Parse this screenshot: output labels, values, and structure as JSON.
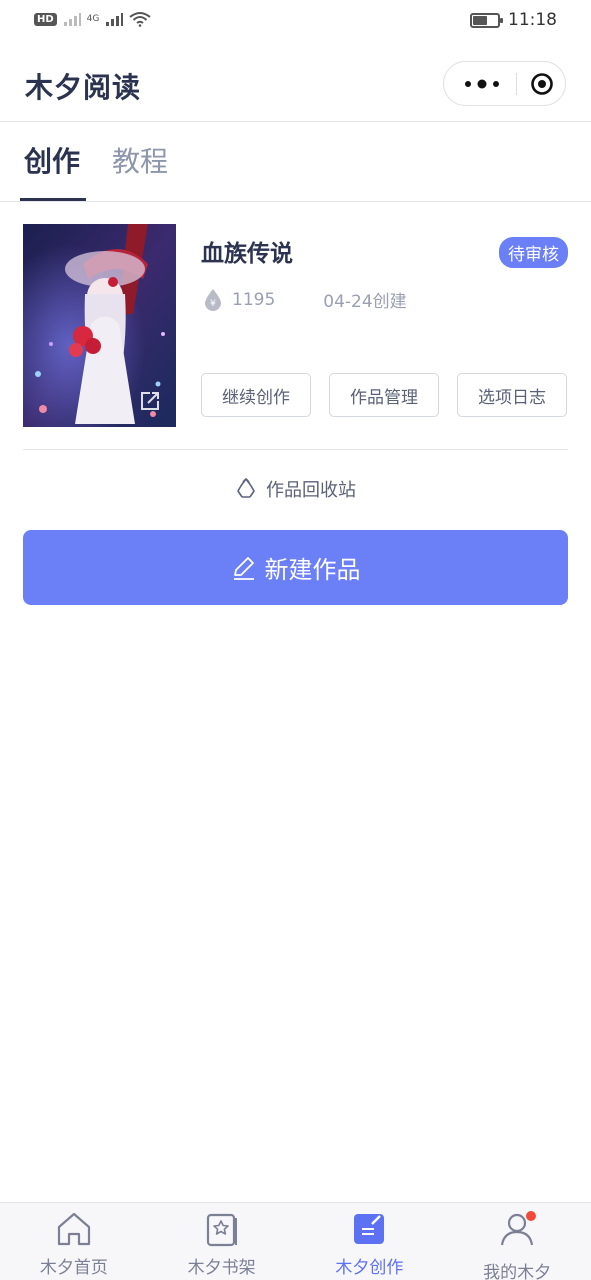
{
  "status_bar": {
    "network_badge": "HD",
    "network_gen": "4G",
    "time": "11:18",
    "battery_level": 0.6
  },
  "header": {
    "title": "木夕阅读"
  },
  "tabs": [
    {
      "label": "创作",
      "active": true
    },
    {
      "label": "教程",
      "active": false
    }
  ],
  "work": {
    "title": "血族传说",
    "status": "待审核",
    "count": "1195",
    "created": "04-24创建",
    "actions": [
      "继续创作",
      "作品管理",
      "选项日志"
    ]
  },
  "recycle_label": "作品回收站",
  "new_work_label": "新建作品",
  "bottom_nav": [
    {
      "label": "木夕首页",
      "icon": "home-icon",
      "active": false
    },
    {
      "label": "木夕书架",
      "icon": "bookshelf-icon",
      "active": false
    },
    {
      "label": "木夕创作",
      "icon": "create-icon",
      "active": true
    },
    {
      "label": "我的木夕",
      "icon": "profile-icon",
      "active": false
    }
  ],
  "colors": {
    "accent": "#6b7ff7",
    "title": "#2b3350",
    "muted": "#9aa0b2",
    "notification": "#f04b3a"
  }
}
